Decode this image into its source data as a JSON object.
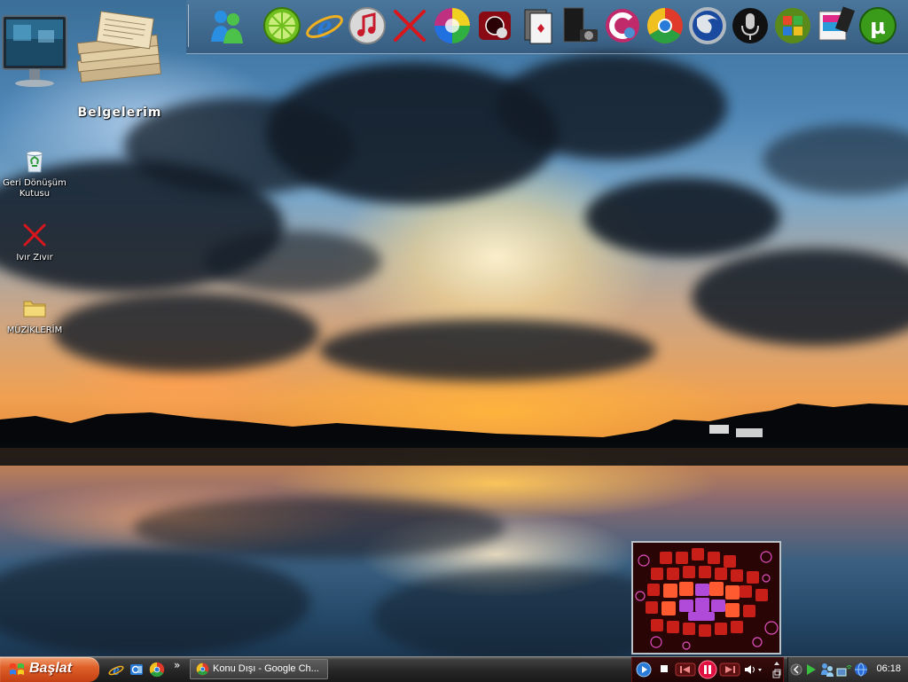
{
  "desktop": {
    "icons": [
      {
        "label": "",
        "icon": "monitor-icon"
      },
      {
        "label": "Belgelerim",
        "icon": "documents-stack-icon"
      },
      {
        "label": "Geri Dönüşüm Kutusu",
        "icon": "recycle-bin-icon"
      },
      {
        "label": "Ivır Zıvır",
        "icon": "red-x-icon"
      },
      {
        "label": "MÜZİKLERİM",
        "icon": "folder-icon"
      }
    ]
  },
  "dock": {
    "icons": [
      "messenger-icon",
      "lime-icon",
      "internet-explorer-icon",
      "itunes-icon",
      "red-x-icon",
      "color-wheel-icon",
      "media-player-icon",
      "cards-icon",
      "camera-icon",
      "ccleaner-icon",
      "chrome-icon",
      "firefox-icon",
      "microphone-icon",
      "windows-icon",
      "photo-icon",
      "utorrent-icon"
    ]
  },
  "taskbar": {
    "start_label": "Başlat",
    "quick_launch": [
      "internet-explorer-icon",
      "outlook-icon",
      "chrome-icon"
    ],
    "overflow_label": "»",
    "task_title": "Konu Dışı - Google Ch...",
    "clock": "06:18"
  },
  "media_player": {
    "controls": [
      "stop-icon",
      "previous-icon",
      "pause-icon",
      "next-icon",
      "volume-icon"
    ]
  },
  "colors": {
    "start_orange": "#e0602a",
    "taskbar_dark": "#262626",
    "player_red": "#3a0c0c"
  }
}
